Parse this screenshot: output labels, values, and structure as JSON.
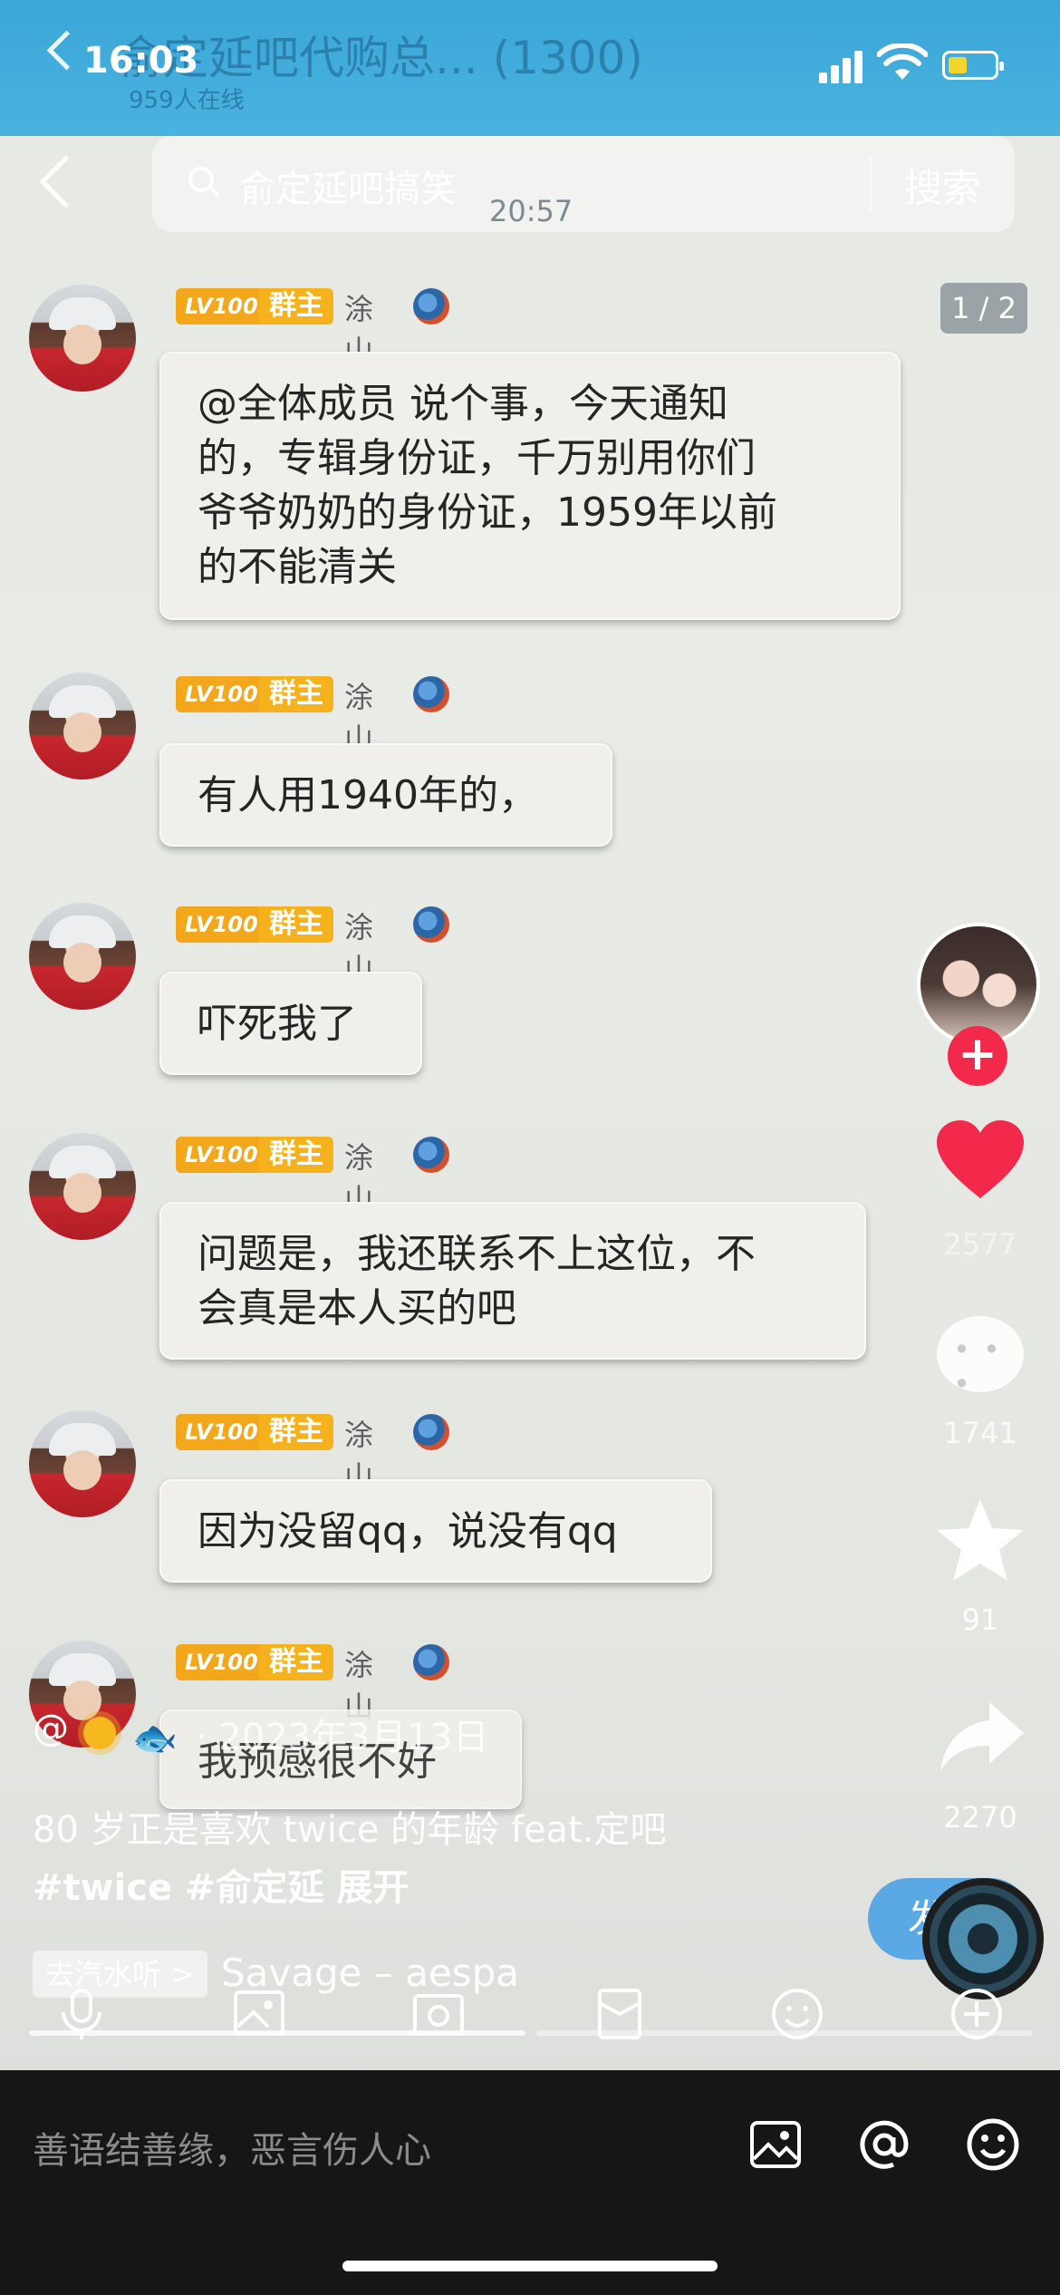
{
  "status_bar": {
    "time": "16:03"
  },
  "group_header": {
    "title": "俞定延吧代购总...  (1300)",
    "online": "959人在线"
  },
  "search": {
    "placeholder": "俞定延吧搞笑",
    "button": "搜索"
  },
  "timestamp": "20:57",
  "page_indicator": "1 / 2",
  "messages": [
    {
      "level": "LV100",
      "role": "群主",
      "name": "涂山",
      "lines": [
        "@全体成员 说个事，今天通知",
        "的，专辑身份证，千万别用你们",
        "爷爷奶奶的身份证，1959年以前",
        "的不能清关"
      ]
    },
    {
      "level": "LV100",
      "role": "群主",
      "name": "涂山",
      "lines": [
        "有人用1940年的，"
      ]
    },
    {
      "level": "LV100",
      "role": "群主",
      "name": "涂山",
      "lines": [
        "吓死我了"
      ]
    },
    {
      "level": "LV100",
      "role": "群主",
      "name": "涂山",
      "lines": [
        "问题是，我还联系不上这位，不",
        "会真是本人买的吧"
      ]
    },
    {
      "level": "LV100",
      "role": "群主",
      "name": "涂山",
      "lines": [
        "因为没留qq，说没有qq"
      ]
    },
    {
      "level": "LV100",
      "role": "群主",
      "name": "涂山",
      "lines": [
        "我预感很不好"
      ]
    }
  ],
  "rail": {
    "likes": "2577",
    "comments": "1741",
    "favorites": "91",
    "shares": "2270"
  },
  "post": {
    "handle": "@",
    "date": "· 2023年3月13日",
    "caption_line1": "80 岁正是喜欢 twice 的年龄 feat.定吧",
    "caption_line2": "#twice #俞定延  展开",
    "music_chip": "去汽水听 >",
    "music_title": "Savage – aespa",
    "send_partial": "发"
  },
  "bottom": {
    "comment_placeholder": "善语结善缘，恶言伤人心"
  },
  "colors": {
    "header_blue": "#3aa7d8",
    "badge_orange": "#f3a71b",
    "like_red": "#f2294b",
    "bottom_bar": "#161616"
  }
}
